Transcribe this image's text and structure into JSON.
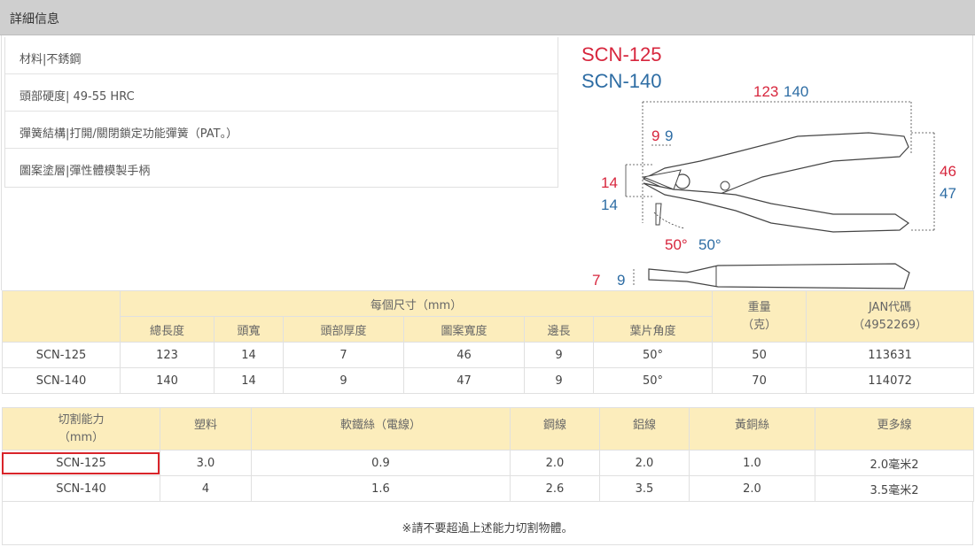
{
  "header": {
    "title": "詳細信息"
  },
  "specs": [
    "材料|不銹鋼",
    "頭部硬度| 49-55 HRC",
    "彈簧結構|打開/關閉鎖定功能彈簧（PAT。）",
    "圖案塗層|彈性體模製手柄"
  ],
  "diagram": {
    "model_a": "SCN-125",
    "model_b": "SCN-140",
    "total_a": "123",
    "total_b": "140",
    "edge_a": "9",
    "edge_b": "9",
    "head_a": "14",
    "head_b": "14",
    "width_a": "46",
    "width_b": "47",
    "angle_a": "50°",
    "angle_b": "50°",
    "thick_a": "7",
    "thick_b": "9",
    "color_a": "#d7263d",
    "color_b": "#2e6da4"
  },
  "dims_table": {
    "group_header": "每個尺寸（mm）",
    "columns": [
      "總長度",
      "頭寬",
      "頭部厚度",
      "圖案寬度",
      "邊長",
      "葉片角度"
    ],
    "weight_header": [
      "重量",
      "（克）"
    ],
    "jan_header": [
      "JAN代碼",
      "（4952269）"
    ],
    "rows": [
      [
        "SCN-125",
        "123",
        "14",
        "7",
        "46",
        "9",
        "50°",
        "50",
        "113631"
      ],
      [
        "SCN-140",
        "140",
        "14",
        "9",
        "47",
        "9",
        "50°",
        "70",
        "114072"
      ]
    ]
  },
  "cut_table": {
    "headers": [
      "切割能力\n（mm）",
      "塑料",
      "軟鐵絲（電線）",
      "鋼線",
      "鋁線",
      "黃銅絲",
      "更多線"
    ],
    "header_line1": "切割能力",
    "header_line2": "（mm）",
    "rows": [
      [
        "SCN-125",
        "3.0",
        "0.9",
        "2.0",
        "2.0",
        "1.0",
        "2.0毫米2"
      ],
      [
        "SCN-140",
        "4",
        "1.6",
        "2.6",
        "3.5",
        "2.0",
        "3.5毫米2"
      ]
    ]
  },
  "note": "※請不要超過上述能力切割物體。"
}
